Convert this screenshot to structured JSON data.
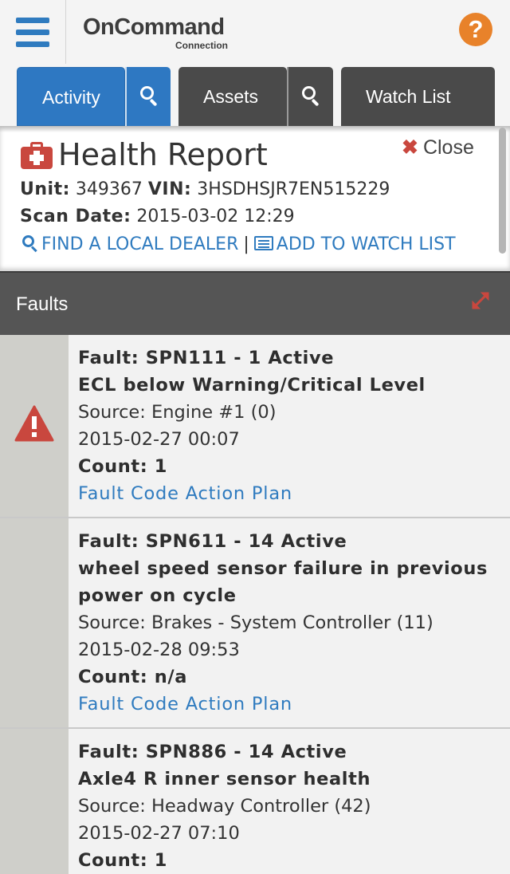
{
  "header": {
    "logo_main": "OnCommand",
    "logo_sub": "Connection",
    "help_label": "?"
  },
  "tabs": [
    {
      "label": "Activity",
      "active": true
    },
    {
      "label": "Assets",
      "active": false
    },
    {
      "label": "Watch List",
      "active": false
    }
  ],
  "report": {
    "title": "Health Report",
    "close_label": "Close",
    "unit_label": "Unit:",
    "unit_value": "349367",
    "vin_label": "VIN:",
    "vin_value": "3HSDHSJR7EN515229",
    "scan_label": "Scan Date:",
    "scan_value": "2015-03-02 12:29",
    "find_dealer": "FIND A LOCAL DEALER",
    "separator": "|",
    "add_watch": "ADD TO WATCH LIST"
  },
  "faults": {
    "title": "Faults",
    "items": [
      {
        "fault": "Fault: SPN111 - 1 Active",
        "description_lines": [
          "ECL below Warning/Critical Level"
        ],
        "source": "Source: Engine #1 (0)",
        "timestamp": "2015-02-27 00:07",
        "count": "Count: 1",
        "action": "Fault Code Action Plan",
        "severity": "critical"
      },
      {
        "fault": "Fault: SPN611 - 14 Active",
        "description_lines": [
          "wheel speed sensor failure in previous",
          "power on cycle"
        ],
        "source": "Source: Brakes - System Controller (11)",
        "timestamp": "2015-02-28 09:53",
        "count": "Count: n/a",
        "action": "Fault Code Action Plan",
        "severity": "none"
      },
      {
        "fault": "Fault: SPN886 - 14 Active",
        "description_lines": [
          "Axle4 R inner sensor health"
        ],
        "source": "Source: Headway Controller (42)",
        "timestamp": "2015-02-27 07:10",
        "count": "Count: 1",
        "action": "",
        "severity": "none"
      }
    ]
  },
  "colors": {
    "brand_blue": "#2e78c2",
    "tab_dark": "#4a4a4a",
    "alert_red": "#c9473e",
    "help_orange": "#e8822a",
    "link_blue": "#2f7bbf"
  },
  "icons": [
    "hamburger-icon",
    "help-icon",
    "search-icon",
    "medical-kit-icon",
    "close-icon",
    "list-icon",
    "expand-icon",
    "warning-icon"
  ]
}
